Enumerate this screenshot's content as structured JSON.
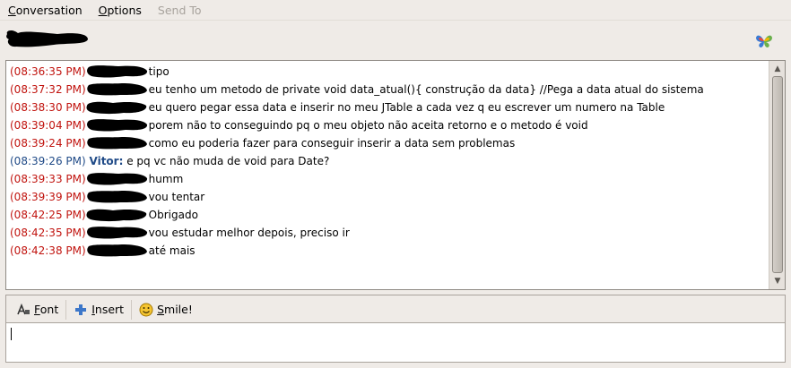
{
  "menubar": {
    "items": [
      {
        "label": "Conversation",
        "accel": "C",
        "rest": "onversation",
        "disabled": false
      },
      {
        "label": "Options",
        "accel": "O",
        "rest": "ptions",
        "disabled": false
      },
      {
        "label": "Send To",
        "accel": "",
        "rest": "Send To",
        "disabled": true
      }
    ]
  },
  "header": {
    "buddy_icon": "butterfly-icon"
  },
  "messages": [
    {
      "time": "(08:36:35 PM)",
      "text": "tipo",
      "self": false
    },
    {
      "time": "(08:37:32 PM)",
      "text": "eu tenho um metodo de private void data_atual(){ construção da data} //Pega a data atual do sistema",
      "self": false
    },
    {
      "time": "(08:38:30 PM)",
      "text": "eu quero pegar essa data e inserir no meu JTable a cada vez q eu escrever um numero na Table",
      "self": false
    },
    {
      "time": "(08:39:04 PM)",
      "text": "porem não to conseguindo pq o meu objeto não aceita retorno e o metodo é void",
      "self": false
    },
    {
      "time": "(08:39:24 PM)",
      "text": "como eu poderia fazer para conseguir inserir a data sem problemas",
      "self": false
    },
    {
      "time": "(08:39:26 PM)",
      "nick": "Vitor:",
      "text": "e pq vc não muda de void para Date?",
      "self": true
    },
    {
      "time": "(08:39:33 PM)",
      "text": "humm",
      "self": false
    },
    {
      "time": "(08:39:39 PM)",
      "text": "vou tentar",
      "self": false
    },
    {
      "time": "(08:42:25 PM)",
      "text": "Obrigado",
      "self": false
    },
    {
      "time": "(08:42:35 PM)",
      "text": "vou estudar melhor depois, preciso ir",
      "self": false
    },
    {
      "time": "(08:42:38 PM)",
      "text": "até mais",
      "self": false
    }
  ],
  "toolbar": {
    "font_accel": "F",
    "font_rest": "ont",
    "insert_accel": "I",
    "insert_rest": "nsert",
    "smile_accel": "S",
    "smile_rest": "mile!"
  },
  "colors": {
    "timestamp_other": "#c1140f",
    "timestamp_self": "#1f4a87"
  }
}
